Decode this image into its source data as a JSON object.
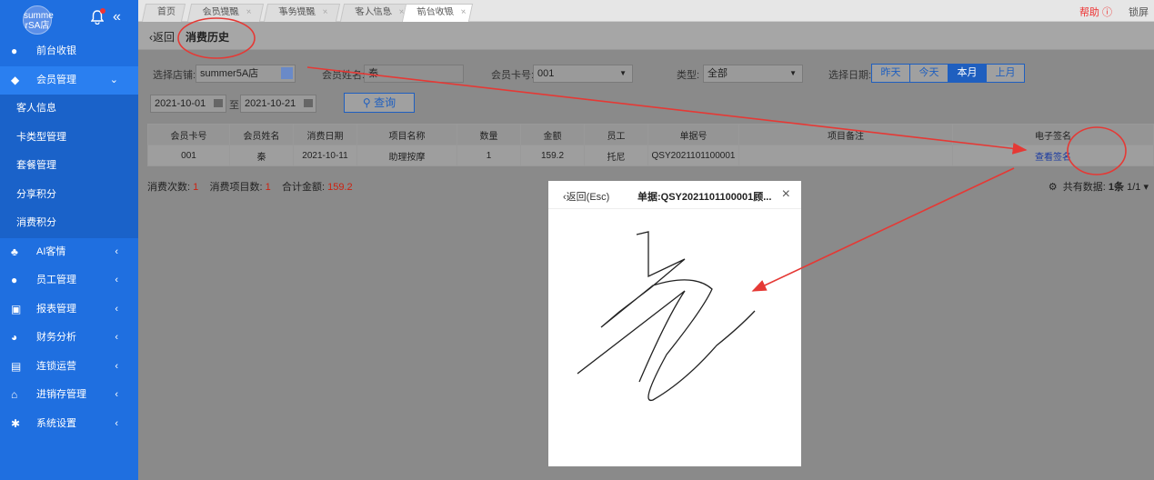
{
  "sidebar": {
    "logo_text": "summerSA店",
    "items": [
      {
        "label": "前台收银",
        "icon": "money-bag-icon",
        "arrow": ""
      },
      {
        "label": "会员管理",
        "icon": "diamond-icon",
        "arrow": "⌄"
      },
      {
        "label": "AI客情",
        "icon": "users-icon",
        "arrow": "‹"
      },
      {
        "label": "员工管理",
        "icon": "user-icon",
        "arrow": "‹"
      },
      {
        "label": "报表管理",
        "icon": "monitor-icon",
        "arrow": "‹"
      },
      {
        "label": "财务分析",
        "icon": "pie-chart-icon",
        "arrow": "‹"
      },
      {
        "label": "连锁运营",
        "icon": "building-icon",
        "arrow": "‹"
      },
      {
        "label": "进销存管理",
        "icon": "home-icon",
        "arrow": "‹"
      },
      {
        "label": "系统设置",
        "icon": "gear-icon",
        "arrow": "‹"
      }
    ],
    "subitems": [
      "客人信息",
      "卡类型管理",
      "套餐管理",
      "分享积分",
      "消费积分"
    ]
  },
  "tabs": [
    "首页",
    "会员提醒",
    "事务提醒",
    "客人信息",
    "前台收银"
  ],
  "header": {
    "help": "帮助",
    "lock": "锁屏"
  },
  "subheader": {
    "back": "‹返回",
    "title": "消费历史"
  },
  "filters": {
    "store_label": "选择店铺:",
    "store_value": "summer5A店",
    "member_name_label": "会员姓名:",
    "member_name_value": "秦",
    "card_label": "会员卡号:",
    "card_value": "001",
    "type_label": "类型:",
    "type_value": "全部",
    "date_label": "选择日期:",
    "date_options": [
      "昨天",
      "今天",
      "本月",
      "上月"
    ],
    "date_selected": "本月",
    "date_from": "2021-10-01",
    "date_sep": "至",
    "date_to": "2021-10-21",
    "query": "查询"
  },
  "table": {
    "headers": [
      "会员卡号",
      "会员姓名",
      "消费日期",
      "项目名称",
      "数量",
      "金额",
      "员工",
      "单据号",
      "项目备注",
      "电子签名"
    ],
    "rows": [
      [
        "001",
        "秦",
        "2021-10-11",
        "助理按摩",
        "1",
        "159.2",
        "托尼",
        "QSY2021101100001",
        "",
        "查看签名"
      ]
    ]
  },
  "summary": {
    "count_label": "消费次数:",
    "count": "1",
    "items_label": "消费项目数:",
    "items": "1",
    "total_label": "合计金额:",
    "total": "159.2",
    "records_label": "共有数据:",
    "records": "1条",
    "page": "1/1"
  },
  "modal": {
    "back": "‹返回(Esc)",
    "title": "单据:QSY2021101100001顾..."
  },
  "colors": {
    "sidebar": "#1f6fe0",
    "accent": "#1f5fbf",
    "annotation": "#e53935"
  }
}
